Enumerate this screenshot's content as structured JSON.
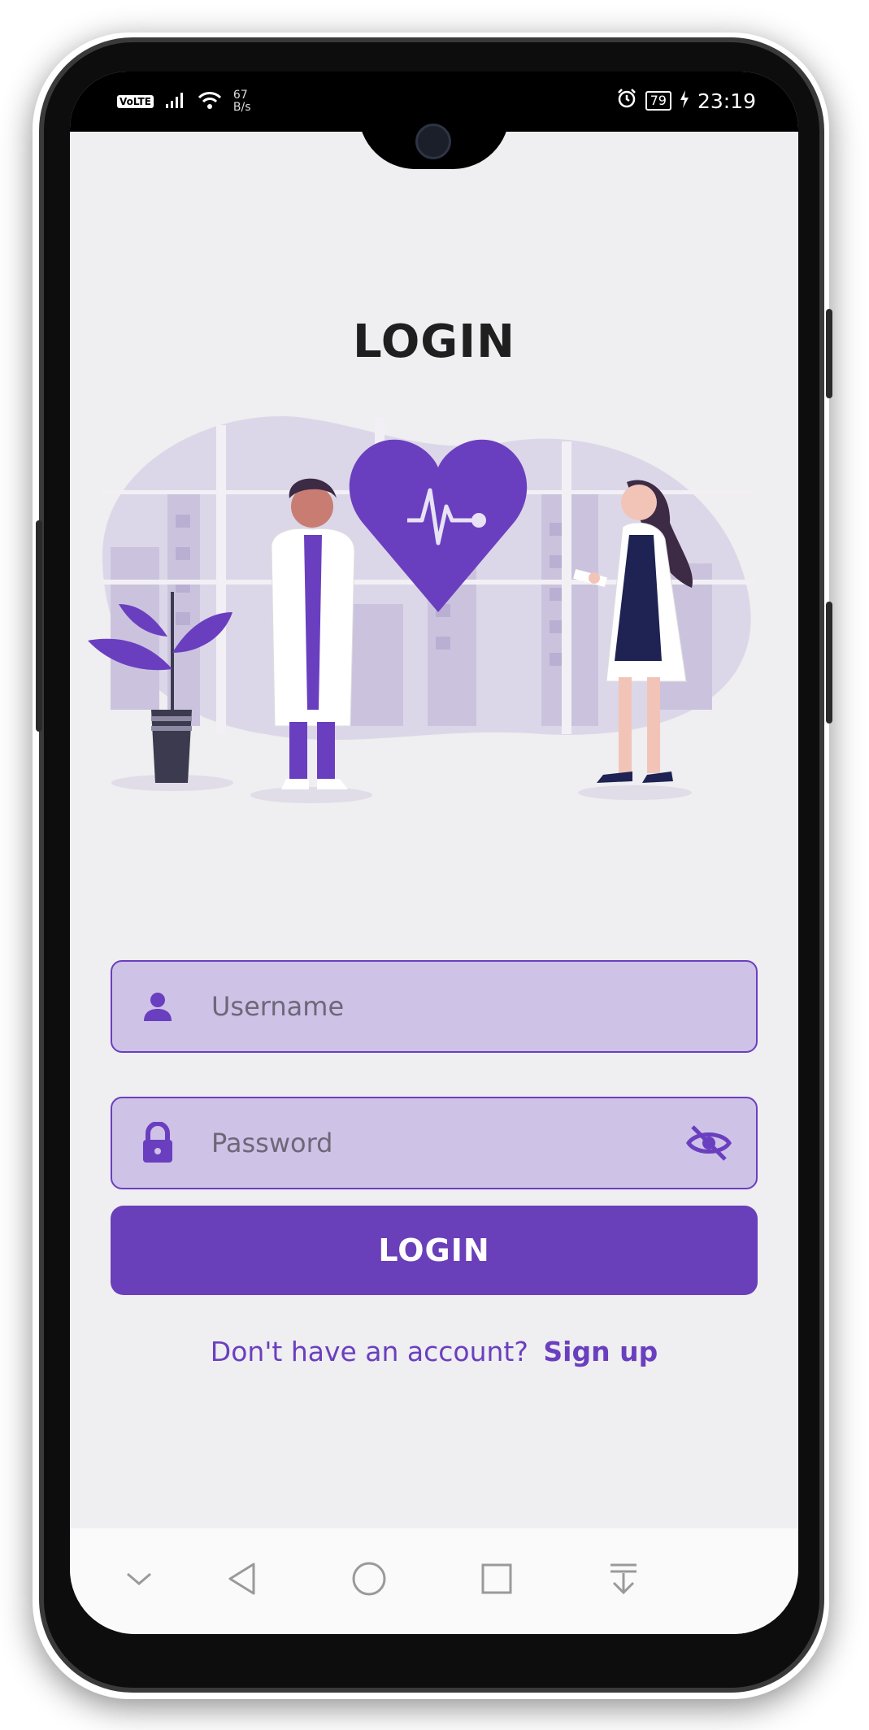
{
  "status_bar": {
    "volte": "VoLTE",
    "net_speed_value": "67",
    "net_speed_unit": "B/s",
    "battery": "79",
    "time": "23:19"
  },
  "login": {
    "title": "LOGIN",
    "username_placeholder": "Username",
    "password_placeholder": "Password",
    "button_label": "LOGIN",
    "signup_prompt": "Don't have an account?",
    "signup_link": "Sign up"
  },
  "nav_bar": {
    "items": [
      "chevron-down-icon",
      "back-icon",
      "home-icon",
      "recents-icon",
      "pull-down-icon"
    ]
  },
  "colors": {
    "accent": "#6a3fba",
    "field_fill": "#cfc2e7",
    "background": "#efeef0"
  }
}
